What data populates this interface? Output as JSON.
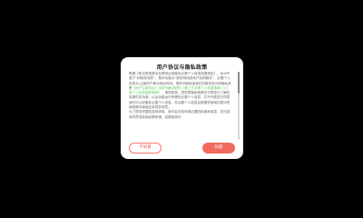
{
  "dialog": {
    "title": "用户协议与隐私政策",
    "paragraphs": [
      {
        "segments": [
          {
            "text": "根据《常见类型移动互联网应用程序必要个人信息范围规定》，本APP属于“网络游戏类”，基本功能为“提供网络游戏产品和服务”，必要个人信息为:注册用户移动电话号码。请您仔细阅读我们的服务协议和隐私政策",
            "highlight": false
          },
          {
            "text": "《用户注册协议》《用户隐私政策》《第三方共享个人信息清单》《儿童个人信息保护规则》",
            "highlight": true
          },
          {
            "text": "，请您知悉，您同意隐私政策仅代表您已了解应用提供的功能，以及功能运行所需的必要个人信息，并不代表您已同意我们可以收集非必要个人信息，非必要个人信息会根据您使用过程中的授权情况单独征求您的同意。",
            "highlight": false
          }
        ]
      },
      {
        "segments": [
          {
            "text": "为了提供完整的游戏体验，我们会向您申请必要的权限和信息。您可选择同意或拒绝权限申请，如果拒绝可",
            "highlight": false
          }
        ]
      }
    ],
    "buttons": {
      "disagree": "不同意",
      "agree": "同意"
    },
    "scroll_position": 0.0
  },
  "colors": {
    "background": "#000000",
    "dialog_background": "#ffffff",
    "link": "#5ac85a",
    "accent": "#f06a5e"
  }
}
